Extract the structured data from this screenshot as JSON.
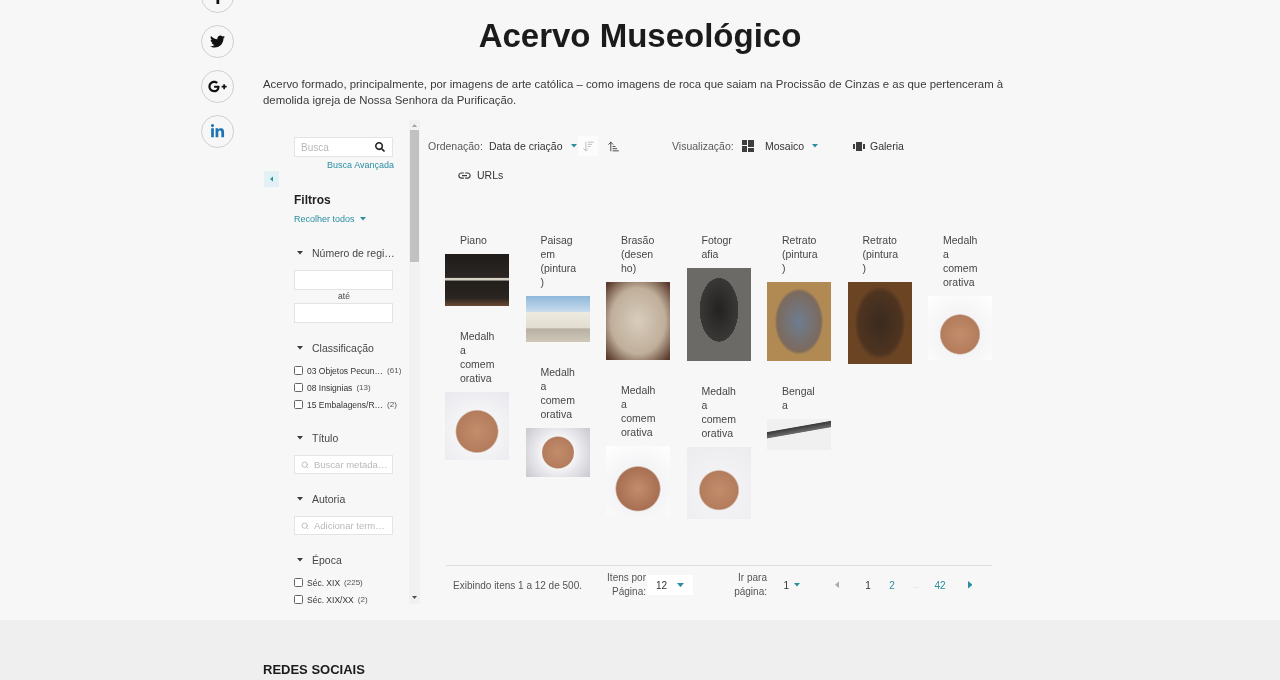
{
  "social_links": [
    {
      "kind": "facebook"
    },
    {
      "kind": "twitter"
    },
    {
      "kind": "google_plus"
    },
    {
      "kind": "linkedin"
    }
  ],
  "title": "Acervo Museológico",
  "description": "Acervo formado, principalmente, por imagens de arte católica – como imagens de roca que saiam na Procissão de Cinzas e as que pertenceram à demolida igreja de Nossa Senhora da Purificação.",
  "filters_panel": {
    "search": {
      "placeholder": "Busca"
    },
    "advanced_search": "Busca Avançada",
    "heading": "Filtros",
    "collapse_all": "Recolher todos",
    "filters": [
      {
        "kind": "range",
        "label": "Número de regi…",
        "expanded": true,
        "separator": "até"
      },
      {
        "kind": "checklist",
        "label": "Classificação",
        "expanded": true,
        "options": [
          {
            "label": "03 Objetos Pecun…",
            "count": "(61)",
            "checked": false
          },
          {
            "label": "08 Insignias",
            "count": "(13)",
            "checked": false
          },
          {
            "label": "15 Embalagens/R…",
            "count": "(2)",
            "checked": false
          }
        ]
      },
      {
        "kind": "search",
        "label": "Título",
        "expanded": true,
        "placeholder": "Buscar metada…"
      },
      {
        "kind": "search",
        "label": "Autoria",
        "expanded": true,
        "placeholder": "Adicionar term…"
      },
      {
        "kind": "checklist",
        "label": "Época",
        "expanded": true,
        "options": [
          {
            "label": "Séc. XIX",
            "count": "(225)",
            "checked": false
          },
          {
            "label": "Séc. XIX/XX",
            "count": "(2)",
            "checked": false
          }
        ]
      }
    ]
  },
  "toolbar": {
    "sort": {
      "label": "Ordenação:",
      "value": "Data de criação",
      "order": [
        {
          "kind": "descending",
          "selected": true
        },
        {
          "kind": "ascending",
          "selected": false
        }
      ]
    },
    "view": {
      "label": "Visualização:",
      "value": "Mosaico"
    },
    "view_buttons": [
      {
        "kind": "gallery",
        "label": "Galeria"
      },
      {
        "kind": "urls",
        "label": "URLs"
      }
    ]
  },
  "items": [
    {
      "title": "Piano"
    },
    {
      "title": "Paisagem (pintura)"
    },
    {
      "title": "Brasão (desenho)"
    },
    {
      "title": "Fotografia"
    },
    {
      "title": "Retrato (pintura)"
    },
    {
      "title": "Retrato (pintura)"
    },
    {
      "title": "Medalha comemorativa"
    },
    {
      "title": "Medalha comemorativa"
    },
    {
      "title": "Medalha comemorativa"
    },
    {
      "title": "Medalha comemorativa"
    },
    {
      "title": "Medalha comemorativa"
    },
    {
      "title": "Bengala"
    }
  ],
  "pagination": {
    "summary": "Exibindo itens 1 a 12 de 500.",
    "per_page_label": "Itens por Página:",
    "per_page": "12",
    "goto_label": "Ir para página:",
    "goto": "1",
    "previous": {
      "disabled": true
    },
    "pages": [
      {
        "kind": "page",
        "label": "1",
        "selected": true
      },
      {
        "kind": "page",
        "label": "2",
        "selected": false
      },
      {
        "kind": "ellipsis",
        "label": "..."
      },
      {
        "kind": "page",
        "label": "42",
        "selected": false
      }
    ],
    "next": {
      "disabled": false
    }
  },
  "footer": {
    "heading": "REDES SOCIAIS"
  }
}
